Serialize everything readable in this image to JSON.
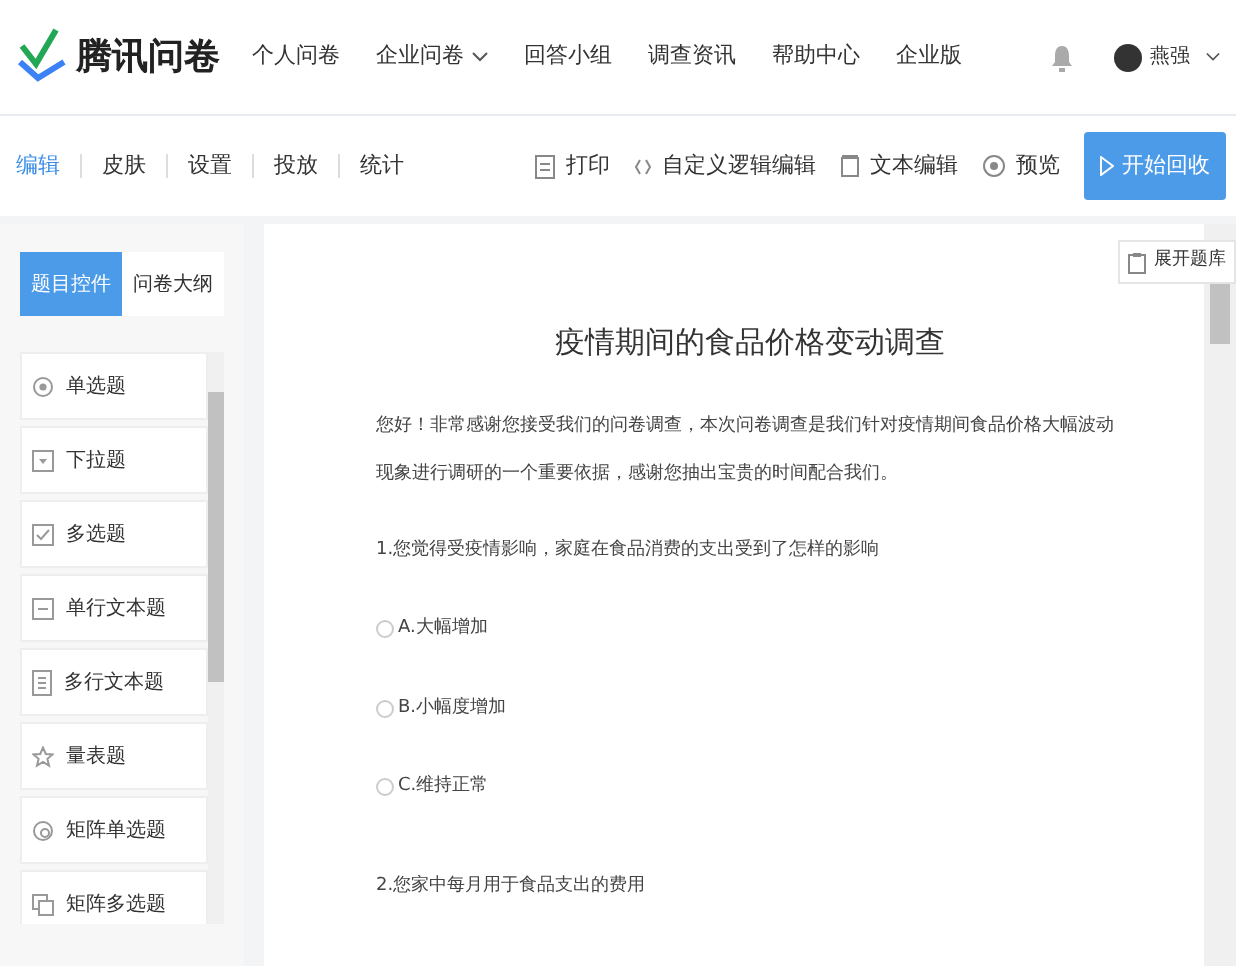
{
  "brand": {
    "name": "腾讯问卷"
  },
  "nav": [
    {
      "label": "个人问卷",
      "dropdown": false
    },
    {
      "label": "企业问卷",
      "dropdown": true
    },
    {
      "label": "回答小组",
      "dropdown": false
    },
    {
      "label": "调查资讯",
      "dropdown": false
    },
    {
      "label": "帮助中心",
      "dropdown": false
    },
    {
      "label": "企业版",
      "dropdown": false
    }
  ],
  "user": {
    "name": "燕强"
  },
  "tabs": [
    {
      "label": "编辑",
      "selected": true
    },
    {
      "label": "皮肤",
      "selected": false
    },
    {
      "label": "设置",
      "selected": false
    },
    {
      "label": "投放",
      "selected": false
    },
    {
      "label": "统计",
      "selected": false
    }
  ],
  "tools": [
    {
      "label": "打印",
      "kind": "print"
    },
    {
      "label": "自定义逻辑编辑",
      "kind": "code"
    },
    {
      "label": "文本编辑",
      "kind": "text"
    },
    {
      "label": "预览",
      "kind": "preview"
    }
  ],
  "start_button": {
    "label": "开始回收"
  },
  "panel_tabs": [
    {
      "label": "题目控件",
      "selected": true
    },
    {
      "label": "问卷大纲",
      "selected": false
    }
  ],
  "controls": [
    {
      "label": "单选题",
      "kind": "radio"
    },
    {
      "label": "下拉题",
      "kind": "dropdown"
    },
    {
      "label": "多选题",
      "kind": "checkbox"
    },
    {
      "label": "单行文本题",
      "kind": "line"
    },
    {
      "label": "多行文本题",
      "kind": "lines"
    },
    {
      "label": "量表题",
      "kind": "star"
    },
    {
      "label": "矩阵单选题",
      "kind": "matrix-radio"
    },
    {
      "label": "矩阵多选题",
      "kind": "matrix-check"
    }
  ],
  "question_bank": {
    "label": "展开题库"
  },
  "survey": {
    "title": "疫情期间的食品价格变动调查",
    "intro": "您好！非常感谢您接受我们的问卷调查，本次问卷调查是我们针对疫情期间食品价格大幅波动现象进行调研的一个重要依据，感谢您抽出宝贵的时间配合我们。",
    "questions": [
      {
        "title": "1.您觉得受疫情影响，家庭在食品消费的支出受到了怎样的影响",
        "options": [
          {
            "label": "A.大幅增加",
            "selected": false
          },
          {
            "label": "B.小幅度增加",
            "selected": false
          },
          {
            "label": "C.维持正常",
            "selected": false
          }
        ]
      },
      {
        "title": "2.您家中每月用于食品支出的费用"
      }
    ]
  }
}
